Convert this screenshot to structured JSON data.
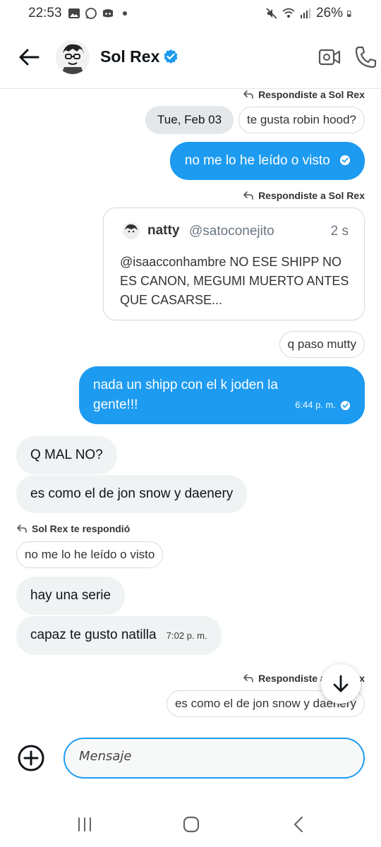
{
  "status_bar": {
    "time": "22:53",
    "battery": "26%",
    "left_icons": [
      "image-icon",
      "whatsapp-icon",
      "discord-icon",
      "dot-icon"
    ],
    "right_icons": [
      "mute-icon",
      "wifi-icon",
      "signal-icon",
      "battery-icon"
    ]
  },
  "header": {
    "name": "Sol Rex",
    "verified": true
  },
  "date_separator": "Tue, Feb 03",
  "messages": {
    "m1_reply_label": "Respondiste a Sol Rex",
    "m1_quote": "te gusta robin hood?",
    "m1_text": "no me lo he leído o visto",
    "m2_reply_label": "Respondiste a Sol Rex",
    "tweet": {
      "name": "natty",
      "handle": "@satoconejito",
      "time": "2 s",
      "text": "@isaacconhambre NO ESE SHIPP NO ES CANON, MEGUMI MUERTO ANTES QUE CASARSE..."
    },
    "m2_quote": "q paso mutty",
    "m2_text_line1": "nada un shipp con el k joden la",
    "m2_text_line2": "gente!!!",
    "m2_time": "6:44 p. m.",
    "in1": "Q MAL NO?",
    "in2": "es como el de jon snow y daenery",
    "in3_reply_label": "Sol Rex te respondió",
    "in3_quote": "no me lo he leído o visto",
    "in3_text": "hay una serie",
    "in4_text": "capaz te gusto natilla",
    "in4_time": "7:02 p. m.",
    "m3_reply_label": "Respondiste a Sol Rex",
    "m3_quote": "es como el de jon snow y daenery"
  },
  "composer": {
    "placeholder": "Mensaje"
  },
  "colors": {
    "accent": "#1d9bf0",
    "incoming_bubble": "#eff3f4"
  }
}
